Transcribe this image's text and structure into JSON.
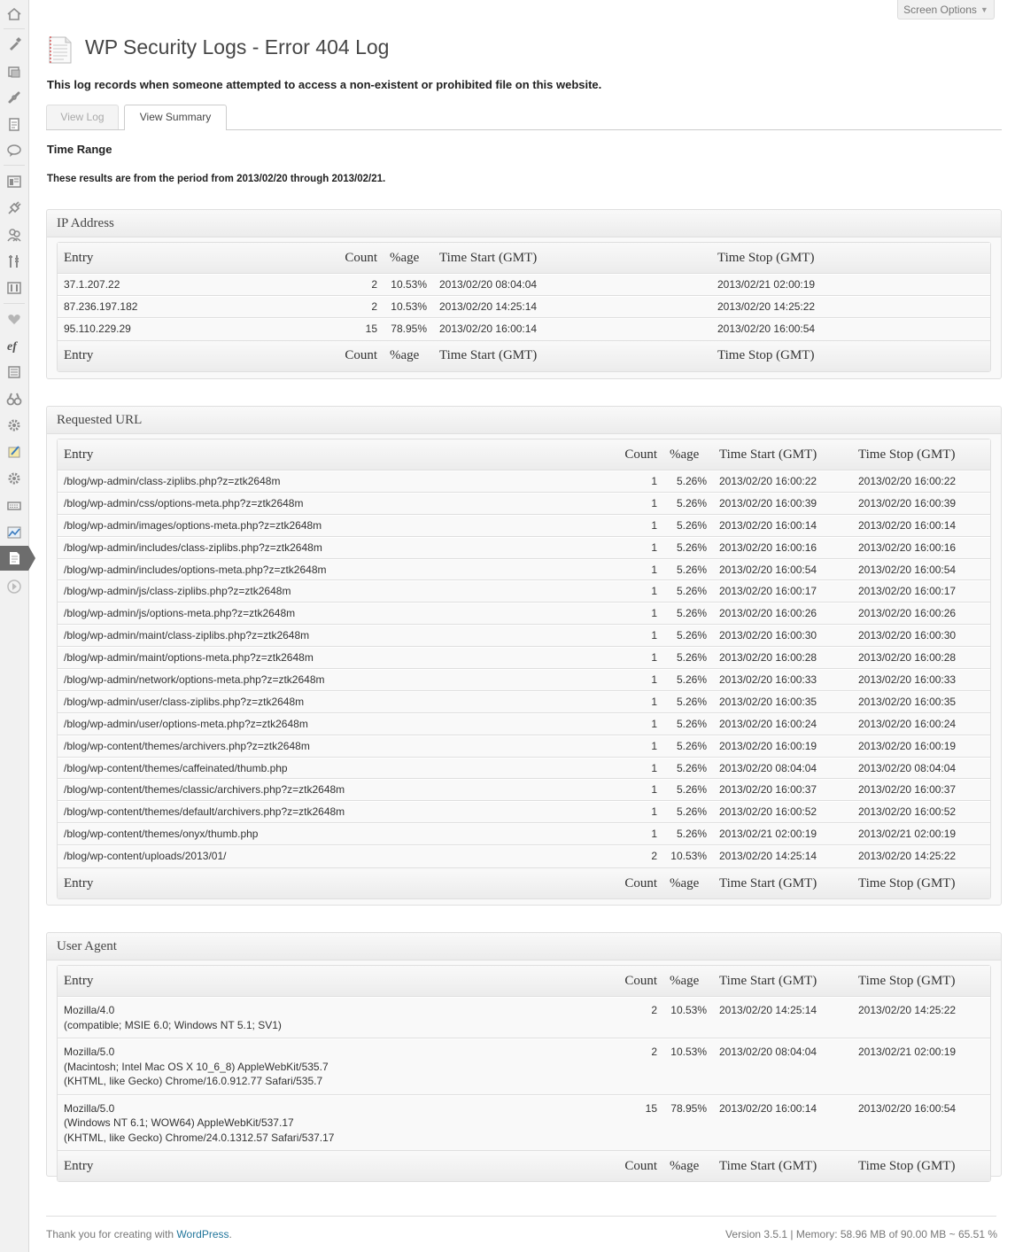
{
  "screen_options": {
    "label": "Screen Options",
    "arrow": "▼"
  },
  "page": {
    "title": "WP Security Logs - Error 404 Log",
    "intro": "This log records when someone attempted to access a non-existent or prohibited file on this website."
  },
  "tabs": [
    {
      "label": "View Log",
      "active": false
    },
    {
      "label": "View Summary",
      "active": true
    }
  ],
  "time_range": {
    "heading": "Time Range",
    "text": "These results are from the period from 2013/02/20 through 2013/02/21."
  },
  "columns": {
    "entry": "Entry",
    "count": "Count",
    "pct": "%age",
    "start": "Time Start (GMT)",
    "stop": "Time Stop (GMT)"
  },
  "ip_box": {
    "title": "IP Address",
    "rows": [
      {
        "entry": "37.1.207.22",
        "count": "2",
        "pct": "10.53%",
        "start": "2013/02/20 08:04:04",
        "stop": "2013/02/21 02:00:19"
      },
      {
        "entry": "87.236.197.182",
        "count": "2",
        "pct": "10.53%",
        "start": "2013/02/20 14:25:14",
        "stop": "2013/02/20 14:25:22"
      },
      {
        "entry": "95.110.229.29",
        "count": "15",
        "pct": "78.95%",
        "start": "2013/02/20 16:00:14",
        "stop": "2013/02/20 16:00:54"
      }
    ]
  },
  "url_box": {
    "title": "Requested URL",
    "rows": [
      {
        "entry": "/blog/wp-admin/class-ziplibs.php?z=ztk2648m",
        "count": "1",
        "pct": "5.26%",
        "start": "2013/02/20 16:00:22",
        "stop": "2013/02/20 16:00:22"
      },
      {
        "entry": "/blog/wp-admin/css/options-meta.php?z=ztk2648m",
        "count": "1",
        "pct": "5.26%",
        "start": "2013/02/20 16:00:39",
        "stop": "2013/02/20 16:00:39"
      },
      {
        "entry": "/blog/wp-admin/images/options-meta.php?z=ztk2648m",
        "count": "1",
        "pct": "5.26%",
        "start": "2013/02/20 16:00:14",
        "stop": "2013/02/20 16:00:14"
      },
      {
        "entry": "/blog/wp-admin/includes/class-ziplibs.php?z=ztk2648m",
        "count": "1",
        "pct": "5.26%",
        "start": "2013/02/20 16:00:16",
        "stop": "2013/02/20 16:00:16"
      },
      {
        "entry": "/blog/wp-admin/includes/options-meta.php?z=ztk2648m",
        "count": "1",
        "pct": "5.26%",
        "start": "2013/02/20 16:00:54",
        "stop": "2013/02/20 16:00:54"
      },
      {
        "entry": "/blog/wp-admin/js/class-ziplibs.php?z=ztk2648m",
        "count": "1",
        "pct": "5.26%",
        "start": "2013/02/20 16:00:17",
        "stop": "2013/02/20 16:00:17"
      },
      {
        "entry": "/blog/wp-admin/js/options-meta.php?z=ztk2648m",
        "count": "1",
        "pct": "5.26%",
        "start": "2013/02/20 16:00:26",
        "stop": "2013/02/20 16:00:26"
      },
      {
        "entry": "/blog/wp-admin/maint/class-ziplibs.php?z=ztk2648m",
        "count": "1",
        "pct": "5.26%",
        "start": "2013/02/20 16:00:30",
        "stop": "2013/02/20 16:00:30"
      },
      {
        "entry": "/blog/wp-admin/maint/options-meta.php?z=ztk2648m",
        "count": "1",
        "pct": "5.26%",
        "start": "2013/02/20 16:00:28",
        "stop": "2013/02/20 16:00:28"
      },
      {
        "entry": "/blog/wp-admin/network/options-meta.php?z=ztk2648m",
        "count": "1",
        "pct": "5.26%",
        "start": "2013/02/20 16:00:33",
        "stop": "2013/02/20 16:00:33"
      },
      {
        "entry": "/blog/wp-admin/user/class-ziplibs.php?z=ztk2648m",
        "count": "1",
        "pct": "5.26%",
        "start": "2013/02/20 16:00:35",
        "stop": "2013/02/20 16:00:35"
      },
      {
        "entry": "/blog/wp-admin/user/options-meta.php?z=ztk2648m",
        "count": "1",
        "pct": "5.26%",
        "start": "2013/02/20 16:00:24",
        "stop": "2013/02/20 16:00:24"
      },
      {
        "entry": "/blog/wp-content/themes/archivers.php?z=ztk2648m",
        "count": "1",
        "pct": "5.26%",
        "start": "2013/02/20 16:00:19",
        "stop": "2013/02/20 16:00:19"
      },
      {
        "entry": "/blog/wp-content/themes/caffeinated/thumb.php",
        "count": "1",
        "pct": "5.26%",
        "start": "2013/02/20 08:04:04",
        "stop": "2013/02/20 08:04:04"
      },
      {
        "entry": "/blog/wp-content/themes/classic/archivers.php?z=ztk2648m",
        "count": "1",
        "pct": "5.26%",
        "start": "2013/02/20 16:00:37",
        "stop": "2013/02/20 16:00:37"
      },
      {
        "entry": "/blog/wp-content/themes/default/archivers.php?z=ztk2648m",
        "count": "1",
        "pct": "5.26%",
        "start": "2013/02/20 16:00:52",
        "stop": "2013/02/20 16:00:52"
      },
      {
        "entry": "/blog/wp-content/themes/onyx/thumb.php",
        "count": "1",
        "pct": "5.26%",
        "start": "2013/02/21 02:00:19",
        "stop": "2013/02/21 02:00:19"
      },
      {
        "entry": "/blog/wp-content/uploads/2013/01/",
        "count": "2",
        "pct": "10.53%",
        "start": "2013/02/20 14:25:14",
        "stop": "2013/02/20 14:25:22"
      }
    ]
  },
  "ua_box": {
    "title": "User Agent",
    "rows": [
      {
        "entry": "Mozilla/4.0\n(compatible; MSIE 6.0; Windows NT 5.1; SV1)",
        "count": "2",
        "pct": "10.53%",
        "start": "2013/02/20 14:25:14",
        "stop": "2013/02/20 14:25:22"
      },
      {
        "entry": "Mozilla/5.0\n(Macintosh; Intel Mac OS X 10_6_8) AppleWebKit/535.7\n(KHTML, like Gecko) Chrome/16.0.912.77 Safari/535.7",
        "count": "2",
        "pct": "10.53%",
        "start": "2013/02/20 08:04:04",
        "stop": "2013/02/21 02:00:19"
      },
      {
        "entry": "Mozilla/5.0\n(Windows NT 6.1; WOW64) AppleWebKit/537.17\n(KHTML, like Gecko) Chrome/24.0.1312.57 Safari/537.17",
        "count": "15",
        "pct": "78.95%",
        "start": "2013/02/20 16:00:14",
        "stop": "2013/02/20 16:00:54"
      }
    ]
  },
  "footer": {
    "thanks": "Thank you for creating with ",
    "link": "WordPress",
    "period": ".",
    "version": "Version 3.5.1 | Memory: 58.96 MB of 90.00 MB ~ 65.51 %"
  },
  "menu_icons": [
    "dashboard-icon",
    "posts-icon",
    "media-icon",
    "links-icon",
    "pages-icon",
    "comments-icon",
    "appearance-icon",
    "plugins-icon",
    "users-icon",
    "tools-icon",
    "settings-icon",
    "heart-icon",
    "edit-flow-icon",
    "forms-icon",
    "binoculars-icon",
    "gear-icon",
    "notes-icon",
    "cog-icon",
    "keyboard-icon",
    "stats-icon",
    "security-logs-icon",
    "collapse-icon"
  ]
}
